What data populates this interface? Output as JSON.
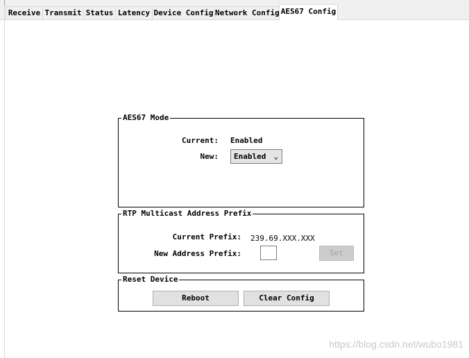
{
  "tabs": [
    {
      "label": "Receive"
    },
    {
      "label": "Transmit"
    },
    {
      "label": "Status"
    },
    {
      "label": "Latency"
    },
    {
      "label": "Device Config"
    },
    {
      "label": "Network Config"
    },
    {
      "label": "AES67 Config",
      "active": true
    }
  ],
  "aes67_mode": {
    "title": "AES67 Mode",
    "current_label": "Current:",
    "current_value": "Enabled",
    "new_label": "New:",
    "new_value": "Enabled"
  },
  "rtp": {
    "title": "RTP Multicast Address Prefix",
    "current_label": "Current Prefix:",
    "current_value": "239.69.XXX.XXX",
    "new_label": "New Address Prefix:",
    "new_value": "",
    "set_label": "Set"
  },
  "reset": {
    "title": "Reset Device",
    "reboot_label": "Reboot",
    "clear_label": "Clear Config"
  },
  "watermark": "https://blog.csdn.net/wubo1981"
}
